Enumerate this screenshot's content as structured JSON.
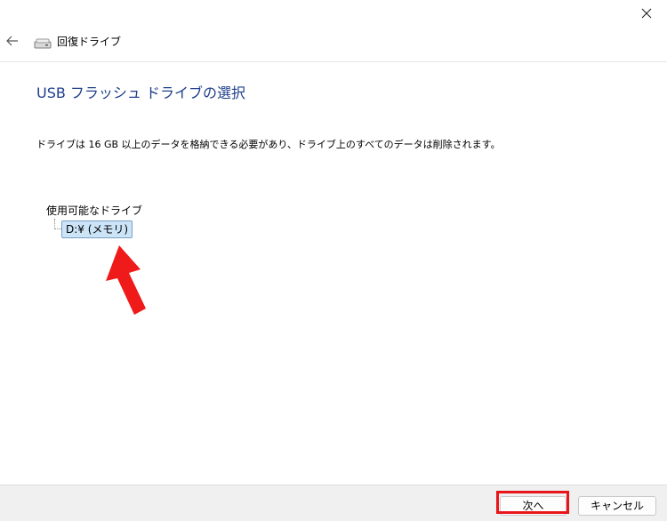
{
  "header": {
    "title": "回復ドライブ"
  },
  "main": {
    "title": "USB フラッシュ ドライブの選択",
    "description": "ドライブは 16 GB 以上のデータを格納できる必要があり、ドライブ上のすべてのデータは削除されます。",
    "available_label": "使用可能なドライブ",
    "drives": [
      {
        "label": "D:¥ (メモリ)",
        "selected": true
      }
    ]
  },
  "footer": {
    "next_label": "次へ",
    "cancel_label": "キャンセル"
  },
  "icons": {
    "close": "close-icon",
    "back": "back-arrow-icon",
    "drive": "drive-icon",
    "annotation_arrow": "red-arrow-icon"
  },
  "colors": {
    "title": "#1e3f8a",
    "selection": "#cce4f7",
    "highlight": "#e8151b"
  }
}
